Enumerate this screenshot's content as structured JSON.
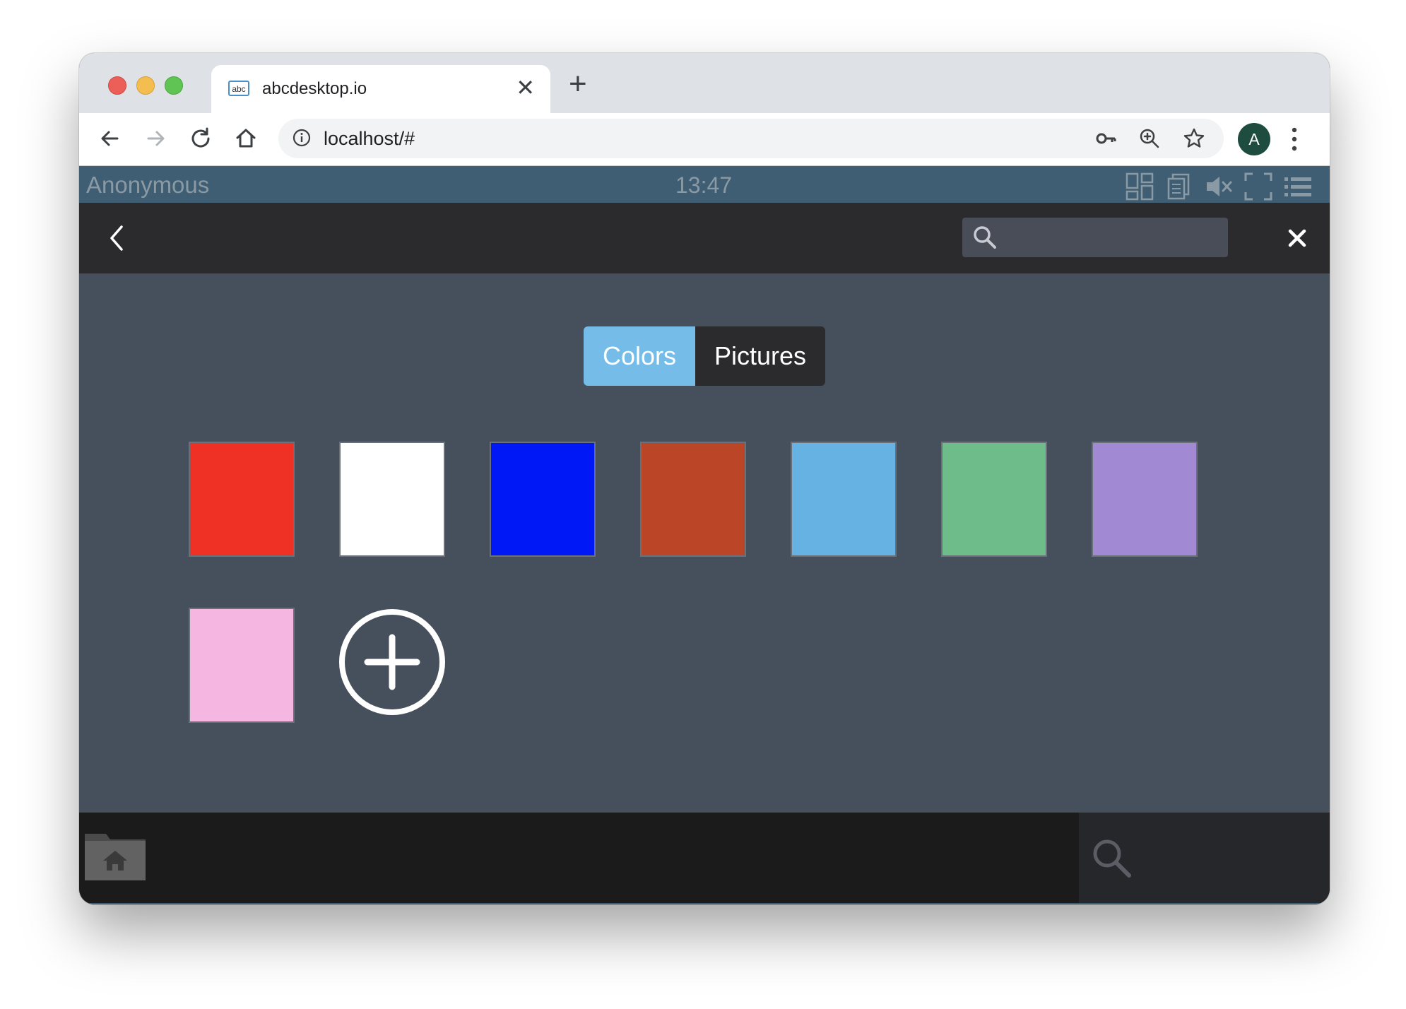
{
  "browser": {
    "tab_title": "abcdesktop.io",
    "favicon_text": "abc",
    "tab_close_glyph": "✕",
    "new_tab_glyph": "+",
    "url": "localhost/#",
    "avatar_initial": "A",
    "icons": [
      "back-arrow-icon",
      "forward-arrow-icon",
      "reload-icon",
      "home-icon",
      "info-icon",
      "key-icon",
      "zoom-icon",
      "star-icon",
      "more-vert-icon"
    ]
  },
  "desktop": {
    "user_name": "Anonymous",
    "clock": "13:47",
    "topbar_icons": [
      "app-grid-icon",
      "clipboard-icon",
      "speaker-muted-icon",
      "fullscreen-icon",
      "list-menu-icon"
    ]
  },
  "panel": {
    "search_placeholder": "",
    "tabs": [
      {
        "label": "Colors",
        "active": true
      },
      {
        "label": "Pictures",
        "active": false
      }
    ],
    "swatches": [
      {
        "color": "#ee3124"
      },
      {
        "color": "#ffffff"
      },
      {
        "color": "#0018f5"
      },
      {
        "color": "#bb4627"
      },
      {
        "color": "#66b3e3"
      },
      {
        "color": "#6ebc8a"
      },
      {
        "color": "#a189d4"
      },
      {
        "color": "#f5b7e1"
      }
    ]
  },
  "colors": {
    "accent": "#75bde8",
    "topbar": "#3f5e73",
    "panel_bg": "#46505c",
    "header_bg": "#2b2b2d",
    "dock_bg": "#1b1b1c"
  }
}
